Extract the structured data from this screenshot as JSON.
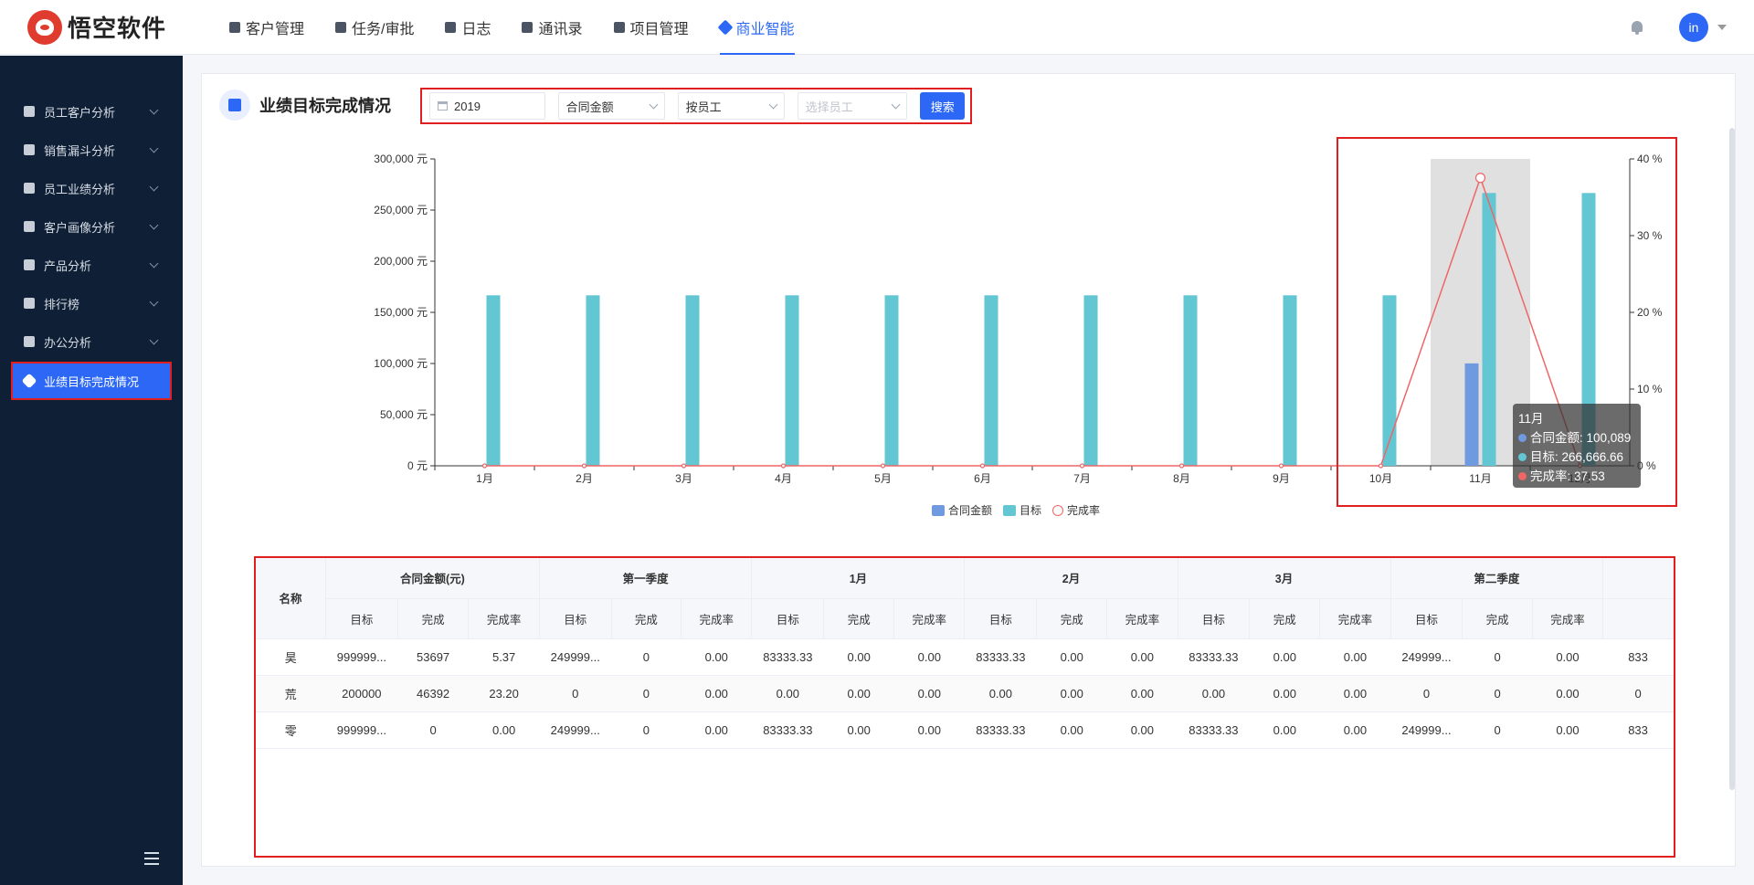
{
  "brand": {
    "name": "悟空软件"
  },
  "topnav": [
    {
      "label": "客户管理",
      "icon": "building-icon"
    },
    {
      "label": "任务/审批",
      "icon": "briefcase-icon"
    },
    {
      "label": "日志",
      "icon": "notebook-icon"
    },
    {
      "label": "通讯录",
      "icon": "phone-book-icon"
    },
    {
      "label": "项目管理",
      "icon": "kanban-icon"
    },
    {
      "label": "商业智能",
      "icon": "bi-icon",
      "active": true
    }
  ],
  "user": {
    "avatar_text": "in"
  },
  "sidebar": {
    "items": [
      {
        "label": "员工客户分析",
        "icon": "person-icon"
      },
      {
        "label": "销售漏斗分析",
        "icon": "funnel-icon"
      },
      {
        "label": "员工业绩分析",
        "icon": "bar-chart-icon"
      },
      {
        "label": "客户画像分析",
        "icon": "people-icon"
      },
      {
        "label": "产品分析",
        "icon": "box-icon"
      },
      {
        "label": "排行榜",
        "icon": "trophy-icon"
      },
      {
        "label": "办公分析",
        "icon": "briefcase-icon"
      },
      {
        "label": "业绩目标完成情况",
        "icon": "target-icon",
        "active": true
      }
    ]
  },
  "page": {
    "title": "业绩目标完成情况"
  },
  "filters": {
    "year": "2019",
    "metric": "合同金额",
    "group_by": "按员工",
    "employee_placeholder": "选择员工",
    "search_label": "搜索"
  },
  "chart_data": {
    "type": "bar",
    "categories": [
      "1月",
      "2月",
      "3月",
      "4月",
      "5月",
      "6月",
      "7月",
      "8月",
      "9月",
      "10月",
      "11月",
      "12月"
    ],
    "series": [
      {
        "name": "合同金额",
        "type": "bar",
        "color": "#6f9ae0",
        "values": [
          0,
          0,
          0,
          0,
          0,
          0,
          0,
          0,
          0,
          0,
          100089,
          0
        ]
      },
      {
        "name": "目标",
        "type": "bar",
        "color": "#63c6d3",
        "values": [
          166666.66,
          166666.66,
          166666.66,
          166666.66,
          166666.66,
          166666.66,
          166666.66,
          166666.66,
          166666.66,
          166666.66,
          266666.66,
          266666.66
        ]
      },
      {
        "name": "完成率",
        "type": "line",
        "axis": "right",
        "color": "#ee6666",
        "values": [
          0,
          0,
          0,
          0,
          0,
          0,
          0,
          0,
          0,
          0,
          37.53,
          0
        ]
      }
    ],
    "y_left": {
      "ticks": [
        "0 元",
        "50,000 元",
        "100,000 元",
        "150,000 元",
        "200,000 元",
        "250,000 元",
        "300,000 元"
      ],
      "ylim": [
        0,
        300000
      ]
    },
    "y_right": {
      "ticks": [
        "0 %",
        "10 %",
        "20 %",
        "30 %",
        "40 %"
      ],
      "ylim": [
        0,
        40
      ]
    },
    "highlight_index": 10,
    "tooltip": {
      "title": "11月",
      "rows": [
        {
          "label": "合同金额: 100,089",
          "color": "#6f9ae0"
        },
        {
          "label": "目标: 266,666.66",
          "color": "#63c6d3"
        },
        {
          "label": "完成率: 37.53",
          "color": "#ee6666"
        }
      ]
    }
  },
  "table": {
    "name_header": "名称",
    "groups": [
      "合同金额(元)",
      "第一季度",
      "1月",
      "2月",
      "3月",
      "第二季度"
    ],
    "sub_headers": [
      "目标",
      "完成",
      "完成率"
    ],
    "rows": [
      {
        "name": "昊",
        "cells": [
          "999999...",
          "53697",
          "5.37",
          "249999...",
          "0",
          "0.00",
          "83333.33",
          "0.00",
          "0.00",
          "83333.33",
          "0.00",
          "0.00",
          "83333.33",
          "0.00",
          "0.00",
          "249999...",
          "0",
          "0.00",
          "833"
        ]
      },
      {
        "name": "荒",
        "cells": [
          "200000",
          "46392",
          "23.20",
          "0",
          "0",
          "0.00",
          "0.00",
          "0.00",
          "0.00",
          "0.00",
          "0.00",
          "0.00",
          "0.00",
          "0.00",
          "0.00",
          "0",
          "0",
          "0.00",
          "0"
        ]
      },
      {
        "name": "零",
        "cells": [
          "999999...",
          "0",
          "0.00",
          "249999...",
          "0",
          "0.00",
          "83333.33",
          "0.00",
          "0.00",
          "83333.33",
          "0.00",
          "0.00",
          "83333.33",
          "0.00",
          "0.00",
          "249999...",
          "0",
          "0.00",
          "833"
        ]
      }
    ]
  }
}
